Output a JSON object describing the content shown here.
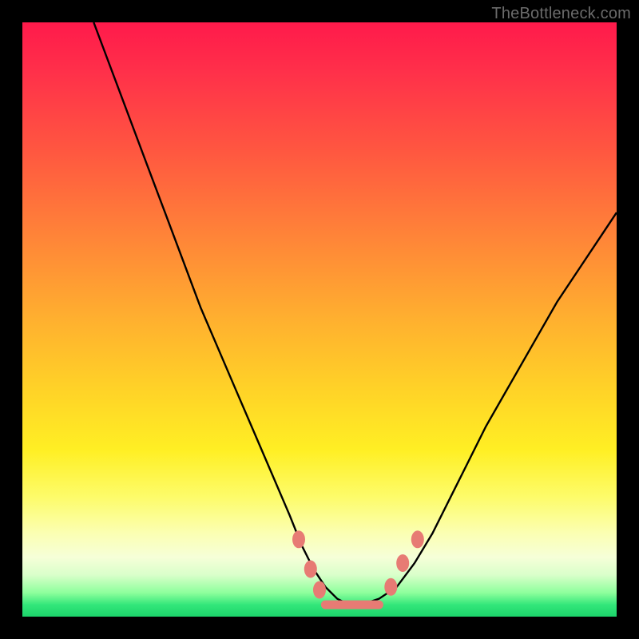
{
  "watermark": "TheBottleneck.com",
  "colors": {
    "background": "#000000",
    "curve": "#000000",
    "marker": "#e77b74",
    "gradient_top": "#ff1a4b",
    "gradient_bottom": "#1cd46b"
  },
  "chart_data": {
    "type": "line",
    "title": "",
    "xlabel": "",
    "ylabel": "",
    "xlim": [
      0,
      100
    ],
    "ylim": [
      0,
      100
    ],
    "curve": {
      "x": [
        12,
        15,
        18,
        21,
        24,
        27,
        30,
        33,
        36,
        39,
        42,
        45,
        47,
        49,
        51,
        53,
        55,
        57,
        60,
        63,
        66,
        69,
        72,
        75,
        78,
        82,
        86,
        90,
        94,
        98,
        100
      ],
      "y": [
        100,
        92,
        84,
        76,
        68,
        60,
        52,
        45,
        38,
        31,
        24,
        17,
        12,
        8,
        5,
        3,
        2,
        2,
        3,
        5,
        9,
        14,
        20,
        26,
        32,
        39,
        46,
        53,
        59,
        65,
        68
      ]
    },
    "flat_minimum": {
      "x_start": 51,
      "x_end": 60,
      "y": 2
    },
    "markers": [
      {
        "x": 46.5,
        "y": 13
      },
      {
        "x": 48.5,
        "y": 8
      },
      {
        "x": 50.0,
        "y": 4.5
      },
      {
        "x": 62.0,
        "y": 5
      },
      {
        "x": 64.0,
        "y": 9
      },
      {
        "x": 66.5,
        "y": 13
      }
    ]
  }
}
